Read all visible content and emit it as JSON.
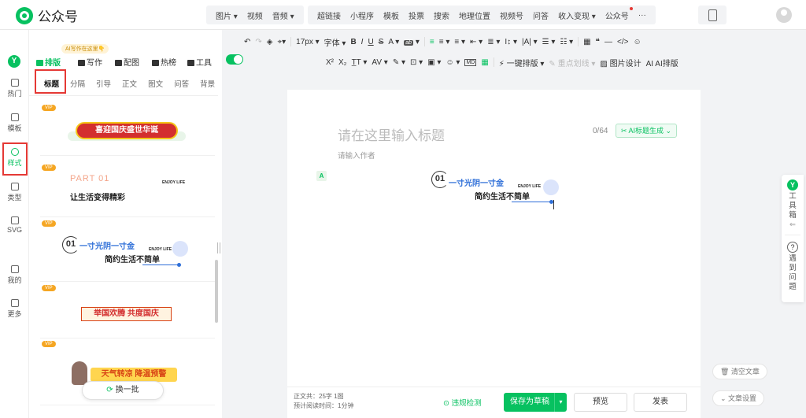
{
  "app": {
    "title": "公众号"
  },
  "topnav": {
    "group1": [
      "图片 ▾",
      "视频",
      "音频 ▾"
    ],
    "group2": [
      "超链接",
      "小程序",
      "模板",
      "投票",
      "搜索",
      "地理位置",
      "视频号",
      "问答",
      "收入变现 ▾",
      "公众号",
      "···"
    ]
  },
  "leftrail": {
    "items": [
      "热门",
      "模板",
      "样式",
      "类型",
      "SVG",
      "我的",
      "更多"
    ]
  },
  "panel": {
    "ai_badge": "AI写作在这里👇",
    "tabs": [
      "排版",
      "写作",
      "配图",
      "热榜",
      "工具"
    ],
    "style_tabs": [
      "标题",
      "分隔",
      "引导",
      "正文",
      "图文",
      "问答",
      "背景"
    ],
    "vip": "VIP",
    "card1": "喜迎国庆盛世华诞",
    "card2": {
      "part": "PART 01",
      "enjoy": "ENJOY LIFE",
      "title": "让生活变得精彩"
    },
    "card3": {
      "num": "01",
      "blue": "一寸光阴一寸金",
      "enjoy": "ENJOY LIFE",
      "title": "简约生活不简单"
    },
    "card4": "举国欢腾 共度国庆",
    "card5": "天气转凉 降温预警",
    "change": "换一批"
  },
  "toolbar": {
    "row1": [
      "↶",
      "↷",
      "◈",
      "⌖▾",
      "17px ▾",
      "字体 ▾",
      "B",
      "I",
      "U",
      "S",
      "A ▾",
      "ab ▾",
      "≡",
      "≡ ▾",
      "≡ ▾",
      "⇤ ▾",
      "≣ ▾",
      "I↕ ▾",
      "|A| ▾",
      "☰ ▾",
      "☷ ▾",
      "▦",
      "❝",
      "—",
      "</>",
      "☺"
    ],
    "row2": [
      "X²",
      "X₂",
      "T̲T ▾",
      "AV ▾",
      "✎ ▾",
      "⊡ ▾",
      "▣ ▾",
      "☺ ▾",
      "MD",
      "▦",
      "⚡ 一键排版 ▾",
      "✎ 重点划线 ▾",
      "▨ 图片设计",
      "AI AI排版"
    ]
  },
  "editor": {
    "title_placeholder": "请在这里输入标题",
    "counter": "0/64",
    "ai_title": "✂ AI标题生成 ⌄",
    "author_placeholder": "请输入作者",
    "insert_icon": "A",
    "block": {
      "num": "01",
      "blue": "一寸光阴一寸金",
      "enjoy": "ENJOY LIFE",
      "title": "简约生活不简单"
    }
  },
  "bottom": {
    "stats1": "正文共：25字 1图",
    "stats2": "预计阅读时间：1分钟",
    "check": "⊙ 违规检测",
    "save": "保存为草稿",
    "preview": "预览",
    "publish": "发表"
  },
  "dock": {
    "toolbox": "工具箱",
    "help": "遇到问题"
  },
  "pills": {
    "clear": "🗑 清空文章",
    "settings": "⌄ 文章设置"
  }
}
